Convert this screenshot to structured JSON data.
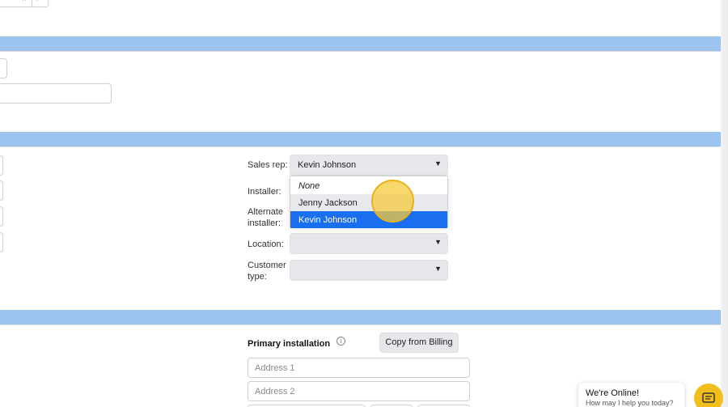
{
  "top_select": {
    "clear_glyph": "×"
  },
  "order": {
    "sales_rep_label": "Sales rep:",
    "sales_rep_value": "Kevin Johnson",
    "installer_label": "Installer:",
    "alternate_installer_label_1": "Alternate",
    "alternate_installer_label_2": "installer:",
    "location_label": "Location:",
    "customer_type_label_1": "Customer",
    "customer_type_label_2": "type:",
    "dropdown_options": [
      {
        "label": "None",
        "style": "italic",
        "state": "normal"
      },
      {
        "label": "Jenny Jackson",
        "style": "normal",
        "state": "hover"
      },
      {
        "label": "Kevin Johnson",
        "style": "normal",
        "state": "selected"
      }
    ]
  },
  "installation": {
    "primary_title": "Primary installation",
    "info_icon": "info-icon",
    "copy_button": "Copy from Billing",
    "address1_placeholder": "Address 1",
    "address2_placeholder": "Address 2"
  },
  "chat": {
    "title": "We're Online!",
    "subtitle": "How may I help you today?",
    "icon": "chat-icon"
  },
  "colors": {
    "section_bar": "#9cc3ee",
    "selected_option": "#1a6ff0",
    "hover_option": "#e8e9ec",
    "chat_accent": "#f2be1c"
  }
}
